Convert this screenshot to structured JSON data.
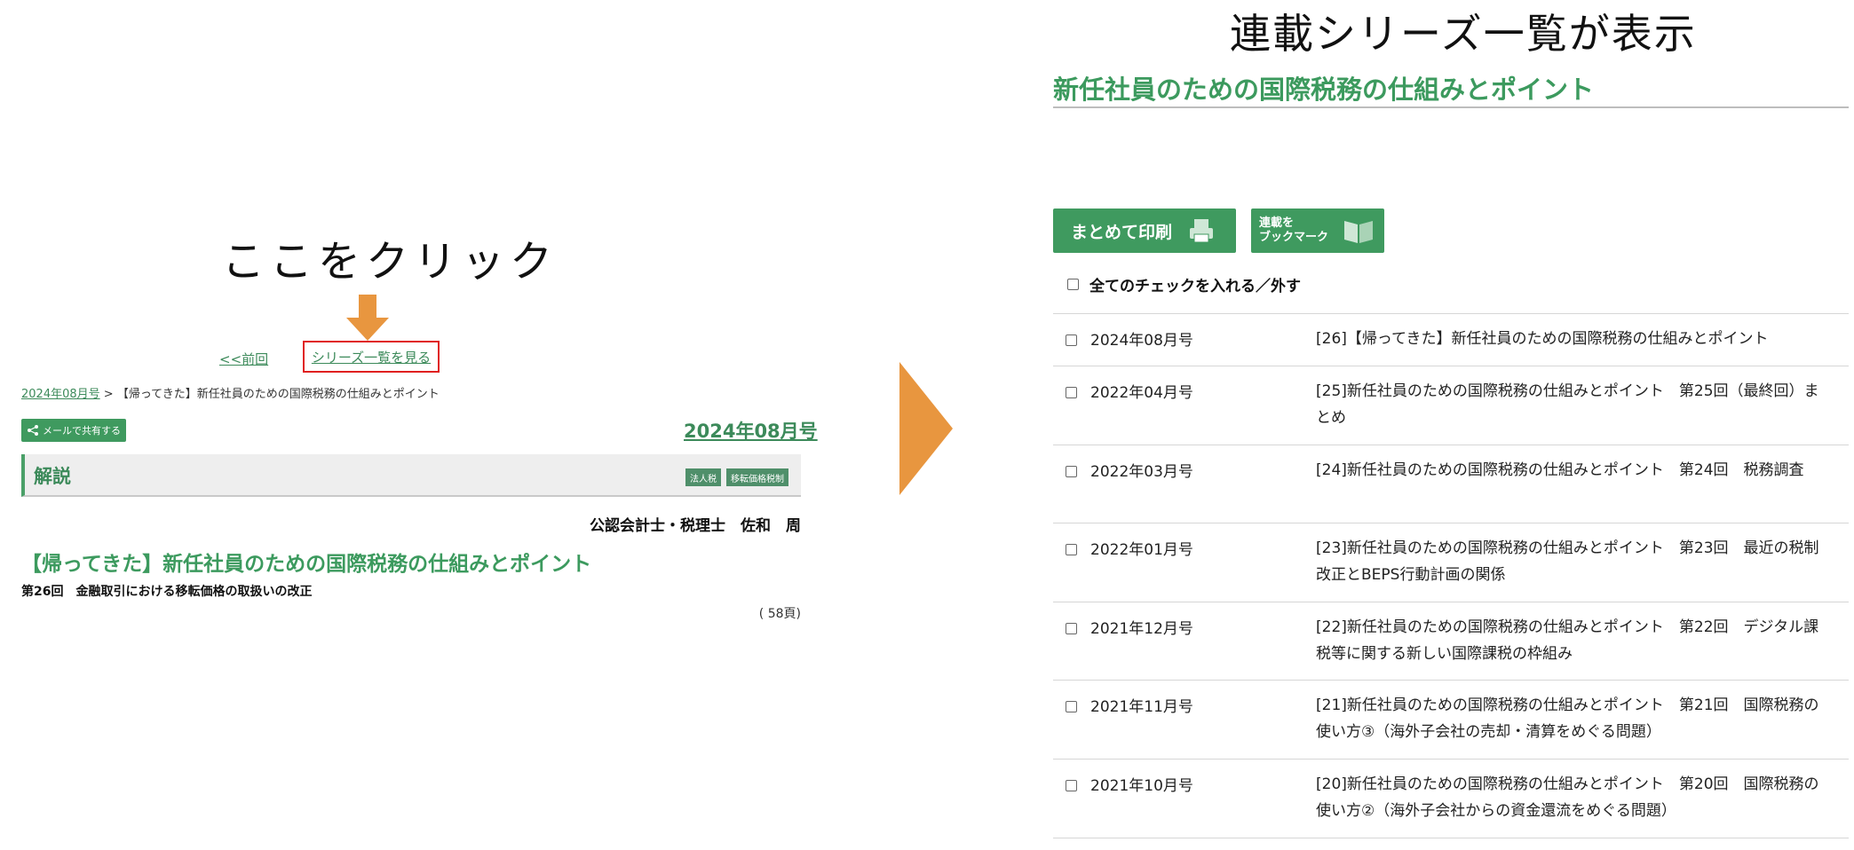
{
  "left": {
    "click_caption": "ここをクリック",
    "nav": {
      "prev": "<<前回",
      "series_link": "シリーズ一覧を見る"
    },
    "breadcrumb": {
      "issue": "2024年08月号",
      "separator": " > ",
      "current": "【帰ってきた】新任社員のための国際税務の仕組みとポイント"
    },
    "share_button": "メールで共有する",
    "issue": "2024年08月号",
    "section": "解説",
    "tags": [
      "法人税",
      "移転価格税制"
    ],
    "author": "公認会計士・税理士　佐和　周",
    "article_title": "【帰ってきた】新任社員のための国際税務の仕組みとポイント",
    "article_subtitle": "第26回　金融取引における移転価格の取扱いの改正",
    "page_ref": "( 58頁)"
  },
  "right": {
    "caption": "連載シリーズ一覧が表示",
    "series_title": "新任社員のための国際税務の仕組みとポイント",
    "print_button": "まとめて印刷",
    "bookmark_button": [
      "連載を",
      "ブックマーク"
    ],
    "check_all": "全てのチェックを入れる／外す",
    "rows": [
      {
        "date": "2024年08月号",
        "title": "[26]【帰ってきた】新任社員のための国際税務の仕組みとポイント"
      },
      {
        "date": "2022年04月号",
        "title": "[25]新任社員のための国際税務の仕組みとポイント　第25回（最終回）まとめ"
      },
      {
        "date": "2022年03月号",
        "title": "[24]新任社員のための国際税務の仕組みとポイント　第24回　税務調査"
      },
      {
        "date": "2022年01月号",
        "title": "[23]新任社員のための国際税務の仕組みとポイント　第23回　最近の税制改正とBEPS行動計画の関係"
      },
      {
        "date": "2021年12月号",
        "title": "[22]新任社員のための国際税務の仕組みとポイント　第22回　デジタル課税等に関する新しい国際課税の枠組み"
      },
      {
        "date": "2021年11月号",
        "title": "[21]新任社員のための国際税務の仕組みとポイント　第21回　国際税務の使い方③（海外子会社の売却・清算をめぐる問題）"
      },
      {
        "date": "2021年10月号",
        "title": "[20]新任社員のための国際税務の仕組みとポイント　第20回　国際税務の使い方②（海外子会社からの資金還流をめぐる問題）"
      }
    ]
  },
  "colors": {
    "accent_green": "#3c9a5e",
    "button_green": "#3f9a5f",
    "arrow_orange": "#e8963f",
    "highlight_red": "#e02020"
  }
}
